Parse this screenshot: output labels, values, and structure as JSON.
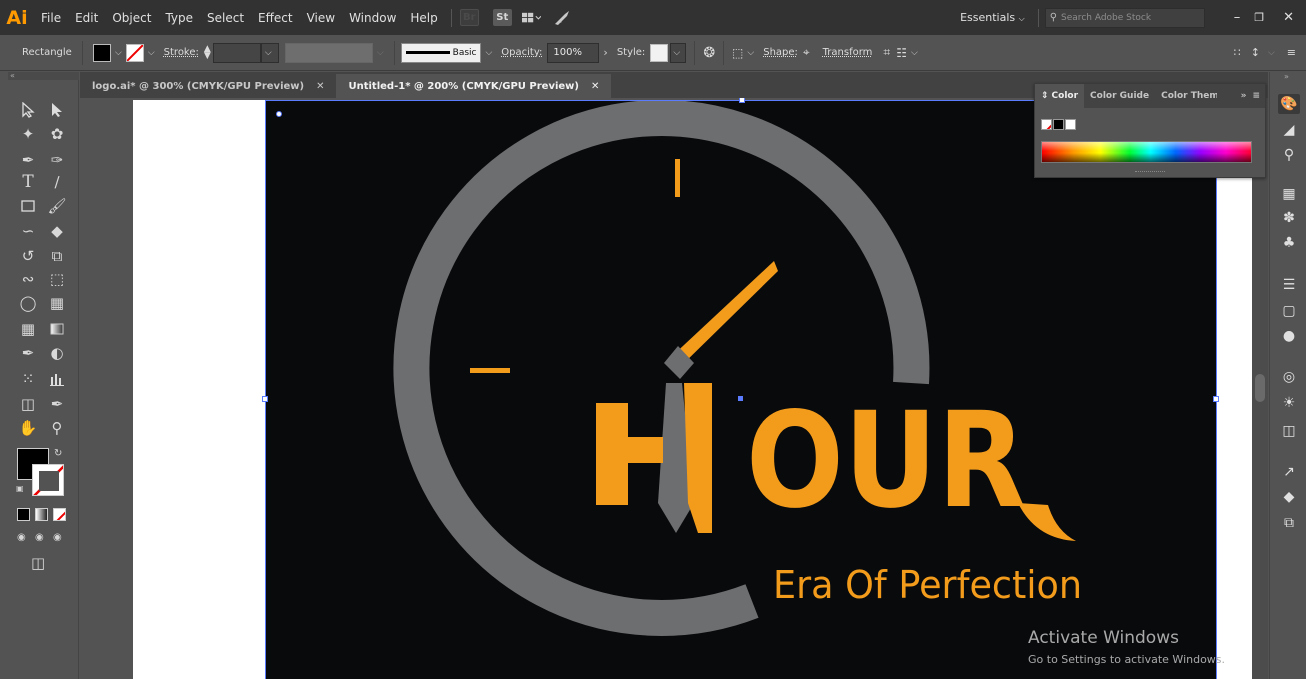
{
  "app": {
    "logo": "Ai",
    "workspace": "Essentials",
    "stock_search_placeholder": "Search Adobe Stock"
  },
  "menu": [
    "File",
    "Edit",
    "Object",
    "Type",
    "Select",
    "Effect",
    "View",
    "Window",
    "Help"
  ],
  "menubar_icons": {
    "bridge": "Br",
    "stock": "St"
  },
  "control_bar": {
    "tool_name": "Rectangle",
    "stroke_label": "Stroke:",
    "brush_label": "Basic",
    "opacity_label": "Opacity:",
    "opacity_value": "100%",
    "style_label": "Style:",
    "shape_label": "Shape:",
    "transform_label": "Transform"
  },
  "tabs": [
    {
      "label": "logo.ai* @ 300% (CMYK/GPU Preview)",
      "active": false
    },
    {
      "label": "Untitled-1* @ 200% (CMYK/GPU Preview)",
      "active": true
    }
  ],
  "color_panel": {
    "tabs": [
      "Color",
      "Color Guide",
      "Color Theme"
    ]
  },
  "artwork": {
    "wordmark": "OUR",
    "wordmark_letter_h": "H",
    "tagline": "Era Of Perfection",
    "colors": {
      "background": "#090a0c",
      "orange": "#f39c1c",
      "gray": "#6d6e70"
    }
  },
  "watermark": {
    "title": "Activate Windows",
    "subtitle": "Go to Settings to activate Windows."
  },
  "icons": [
    "selection-icon",
    "direct-selection-icon",
    "magic-wand-icon",
    "lasso-icon",
    "pen-icon",
    "curvature-icon",
    "type-icon",
    "line-icon",
    "rectangle-icon",
    "paintbrush-icon",
    "shaper-icon",
    "eraser-icon",
    "rotate-icon",
    "scale-icon",
    "width-icon",
    "free-transform-icon",
    "shape-builder-icon",
    "perspective-grid-icon",
    "mesh-icon",
    "gradient-icon",
    "eyedropper-icon",
    "blend-icon",
    "symbol-sprayer-icon",
    "graph-icon",
    "artboard-icon",
    "slice-icon",
    "hand-icon",
    "zoom-icon"
  ]
}
